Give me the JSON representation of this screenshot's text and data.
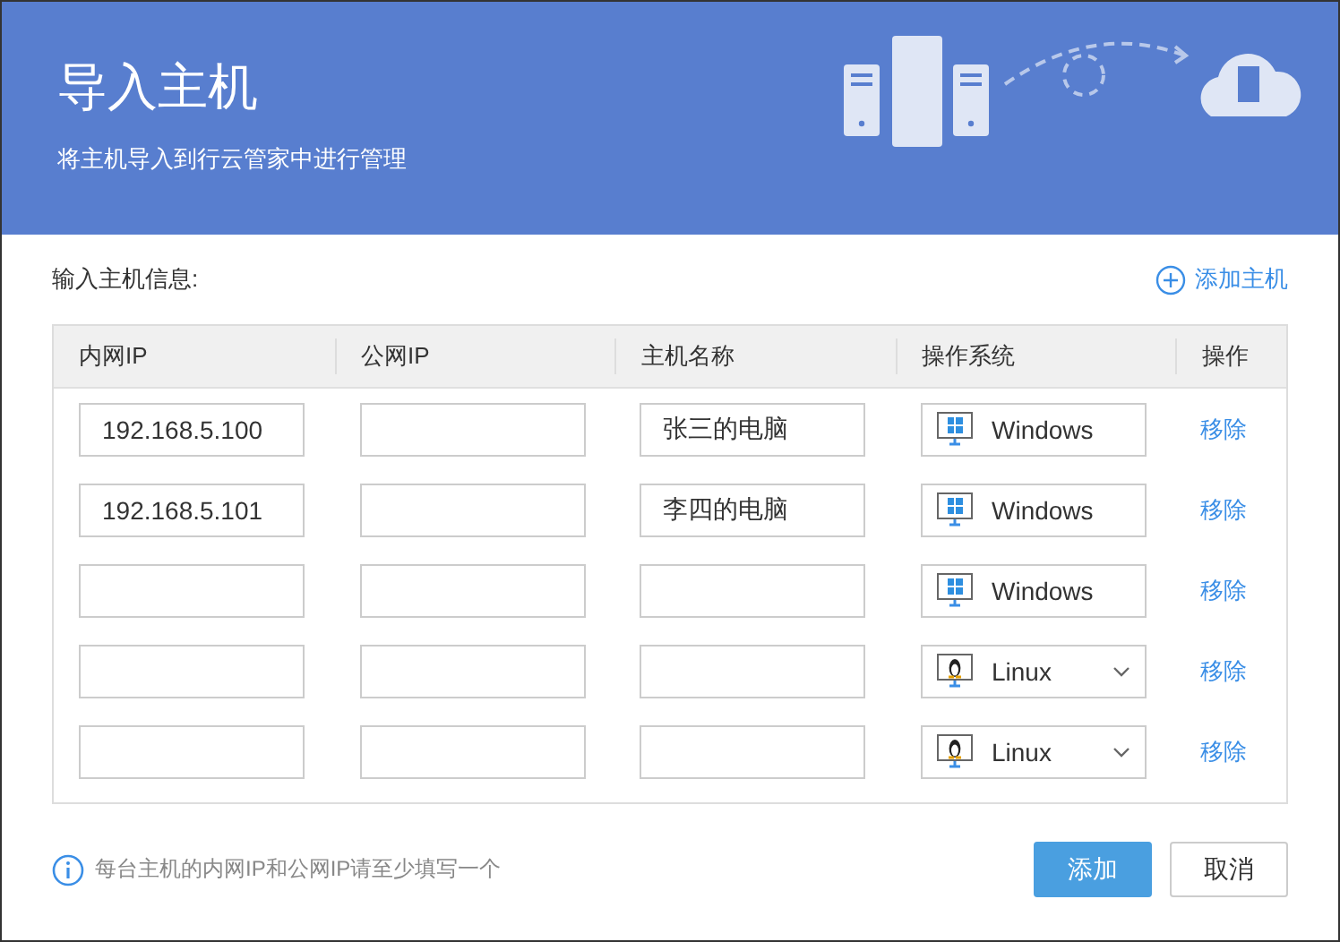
{
  "header": {
    "title": "导入主机",
    "subtitle": "将主机导入到行云管家中进行管理"
  },
  "section_label": "输入主机信息:",
  "add_host_link": "添加主机",
  "table": {
    "columns": [
      "内网IP",
      "公网IP",
      "主机名称",
      "操作系统",
      "操作"
    ],
    "rows": [
      {
        "private_ip": "192.168.5.100",
        "public_ip": "",
        "host_name": "张三的电脑",
        "os": {
          "kind": "windows",
          "label": "Windows",
          "dropdown": false
        },
        "action": "移除"
      },
      {
        "private_ip": "192.168.5.101",
        "public_ip": "",
        "host_name": "李四的电脑",
        "os": {
          "kind": "windows",
          "label": "Windows",
          "dropdown": false
        },
        "action": "移除"
      },
      {
        "private_ip": "",
        "public_ip": "",
        "host_name": "",
        "os": {
          "kind": "windows",
          "label": "Windows",
          "dropdown": false
        },
        "action": "移除"
      },
      {
        "private_ip": "",
        "public_ip": "",
        "host_name": "",
        "os": {
          "kind": "linux",
          "label": "Linux",
          "dropdown": true
        },
        "action": "移除"
      },
      {
        "private_ip": "",
        "public_ip": "",
        "host_name": "",
        "os": {
          "kind": "linux",
          "label": "Linux",
          "dropdown": true
        },
        "action": "移除"
      }
    ]
  },
  "hint": "每台主机的内网IP和公网IP请至少填写一个",
  "buttons": {
    "primary": "添加",
    "secondary": "取消"
  }
}
